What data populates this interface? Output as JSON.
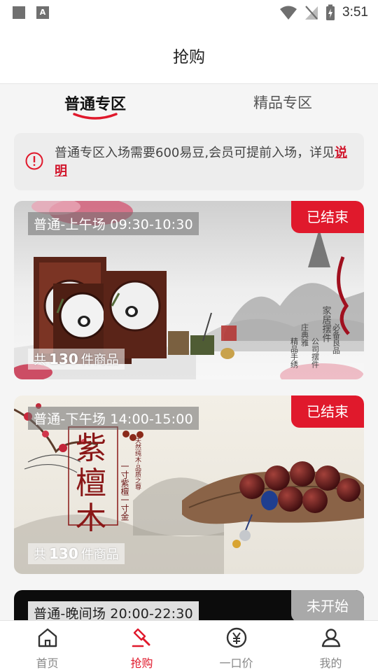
{
  "status_bar": {
    "time": "3:51"
  },
  "header": {
    "title": "抢购"
  },
  "tabs": [
    {
      "label": "普通专区",
      "active": true
    },
    {
      "label": "精品专区",
      "active": false
    }
  ],
  "notice": {
    "text": "普通专区入场需要600易豆,会员可提前入场，详见",
    "link": "说明"
  },
  "sessions": [
    {
      "title": "普通-上午场 09:30-10:30",
      "status": "已结束",
      "count_prefix": "共",
      "count": "130",
      "count_suffix": "件商品"
    },
    {
      "title": "普通-下午场 14:00-15:00",
      "status": "已结束",
      "count_prefix": "共",
      "count": "130",
      "count_suffix": "件商品"
    },
    {
      "title": "普通-晚间场 20:00-22:30",
      "status": "未开始"
    }
  ],
  "card_art_text": {
    "card1_vertical": [
      "家居摆件",
      "庄典雅",
      "公司摆件",
      "精品手绣",
      "必备良品"
    ],
    "card2_big": [
      "紫",
      "檀",
      "木"
    ],
    "card2_small": [
      "一寸紫檀一寸金",
      "天然纯木·品质之尊"
    ]
  },
  "bottom_nav": [
    {
      "label": "首页",
      "icon": "home-icon",
      "active": false
    },
    {
      "label": "抢购",
      "icon": "auction-hammer-icon",
      "active": true
    },
    {
      "label": "一口价",
      "icon": "yuan-coin-icon",
      "active": false
    },
    {
      "label": "我的",
      "icon": "user-icon",
      "active": false
    }
  ],
  "colors": {
    "accent": "#e0192c",
    "pending": "#a9a9a9",
    "background": "#f5f5f5"
  }
}
